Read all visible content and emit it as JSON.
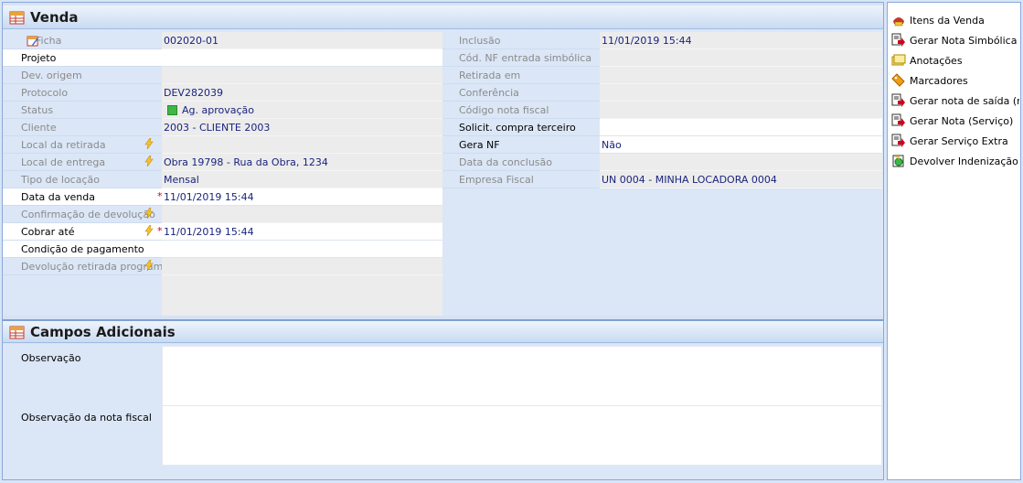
{
  "section1": {
    "title": "Venda"
  },
  "section2": {
    "title": "Campos Adicionais"
  },
  "left_fields": [
    {
      "label": "Ficha",
      "value": "002020-01"
    },
    {
      "label": "Projeto",
      "value": ""
    },
    {
      "label": "Dev. origem",
      "value": ""
    },
    {
      "label": "Protocolo",
      "value": "DEV282039"
    },
    {
      "label": "Status",
      "value": "Ag. aprovação"
    },
    {
      "label": "Cliente",
      "value": "2003 - CLIENTE  2003"
    },
    {
      "label": "Local da retirada",
      "value": ""
    },
    {
      "label": "Local de entrega",
      "value": "Obra 19798 - Rua da Obra, 1234"
    },
    {
      "label": "Tipo de locação",
      "value": "Mensal"
    },
    {
      "label": "Data da venda",
      "value": "11/01/2019 15:44"
    },
    {
      "label": "Confirmação de devolução",
      "value": ""
    },
    {
      "label": "Cobrar até",
      "value": "11/01/2019 15:44"
    },
    {
      "label": "Condição de pagamento",
      "value": ""
    },
    {
      "label": "Devolução retirada programada",
      "value": ""
    }
  ],
  "right_fields": [
    {
      "label": "Inclusão",
      "value": "11/01/2019 15:44"
    },
    {
      "label": "Cód. NF entrada simbólica",
      "value": ""
    },
    {
      "label": "Retirada em",
      "value": ""
    },
    {
      "label": "Conferência",
      "value": ""
    },
    {
      "label": "Código nota fiscal",
      "value": ""
    },
    {
      "label": "Solicit. compra terceiro",
      "value": ""
    },
    {
      "label": "Gera NF",
      "value": "Não"
    },
    {
      "label": "Data da conclusão",
      "value": ""
    },
    {
      "label": "Empresa Fiscal",
      "value": "UN 0004 - MINHA LOCADORA 0004"
    }
  ],
  "additional": {
    "observacao_label": "Observação",
    "observacao_nf_label": "Observação da nota fiscal"
  },
  "sidebar": {
    "items": [
      {
        "label": "Itens da Venda",
        "icon": "items-icon"
      },
      {
        "label": "Gerar Nota Simbólica",
        "icon": "doc-arrow-icon"
      },
      {
        "label": "Anotações",
        "icon": "notes-icon"
      },
      {
        "label": "Marcadores",
        "icon": "tag-icon"
      },
      {
        "label": "Gerar nota de saída (mer",
        "icon": "doc-arrow-icon"
      },
      {
        "label": "Gerar Nota (Serviço)",
        "icon": "doc-arrow-icon"
      },
      {
        "label": "Gerar Serviço Extra",
        "icon": "doc-arrow-icon"
      },
      {
        "label": "Devolver Indenização",
        "icon": "refund-icon"
      }
    ]
  },
  "colors": {
    "accent": "#1a237e",
    "required": "#d0021b",
    "status_ok": "#3cb844"
  }
}
